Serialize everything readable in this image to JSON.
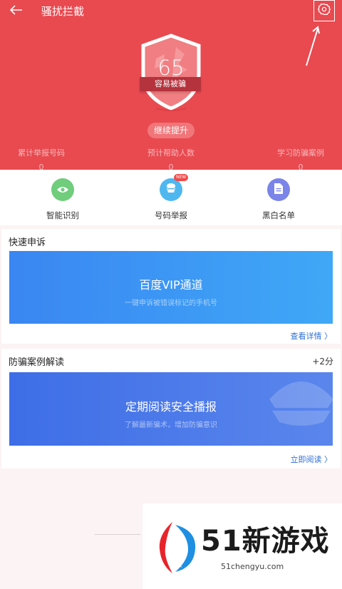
{
  "header": {
    "title": "骚扰拦截",
    "score": "65",
    "score_label": "容易被骗",
    "improve_label": "继续提升",
    "stats": [
      {
        "label": "累计举报号码",
        "value": "0"
      },
      {
        "label": "预计帮助人数",
        "value": "0"
      },
      {
        "label": "学习防骗案例",
        "value": "0"
      }
    ]
  },
  "features": [
    {
      "label": "智能识别",
      "icon": "eye-icon"
    },
    {
      "label": "号码举报",
      "icon": "report-icon",
      "badge": "NEW"
    },
    {
      "label": "黑白名单",
      "icon": "document-icon"
    }
  ],
  "quick_appeal": {
    "title": "快速申诉",
    "banner_title": "百度VIP通道",
    "banner_sub": "一键申诉被错误标记的手机号",
    "link": "查看详情 〉"
  },
  "fraud_cases": {
    "title": "防骗案例解读",
    "points": "+2分",
    "banner_title": "定期阅读安全播报",
    "banner_sub": "了解最新骗术，增加防骗意识",
    "link": "立即阅读 〉"
  },
  "watermark": {
    "brand": "51新游戏",
    "url": "51chengyu.com"
  },
  "colors": {
    "header_bg": "#e84a50",
    "link": "#2f6fd6",
    "eye": "#6fcd7c",
    "report": "#4fb7f0",
    "list": "#7b84e8"
  }
}
